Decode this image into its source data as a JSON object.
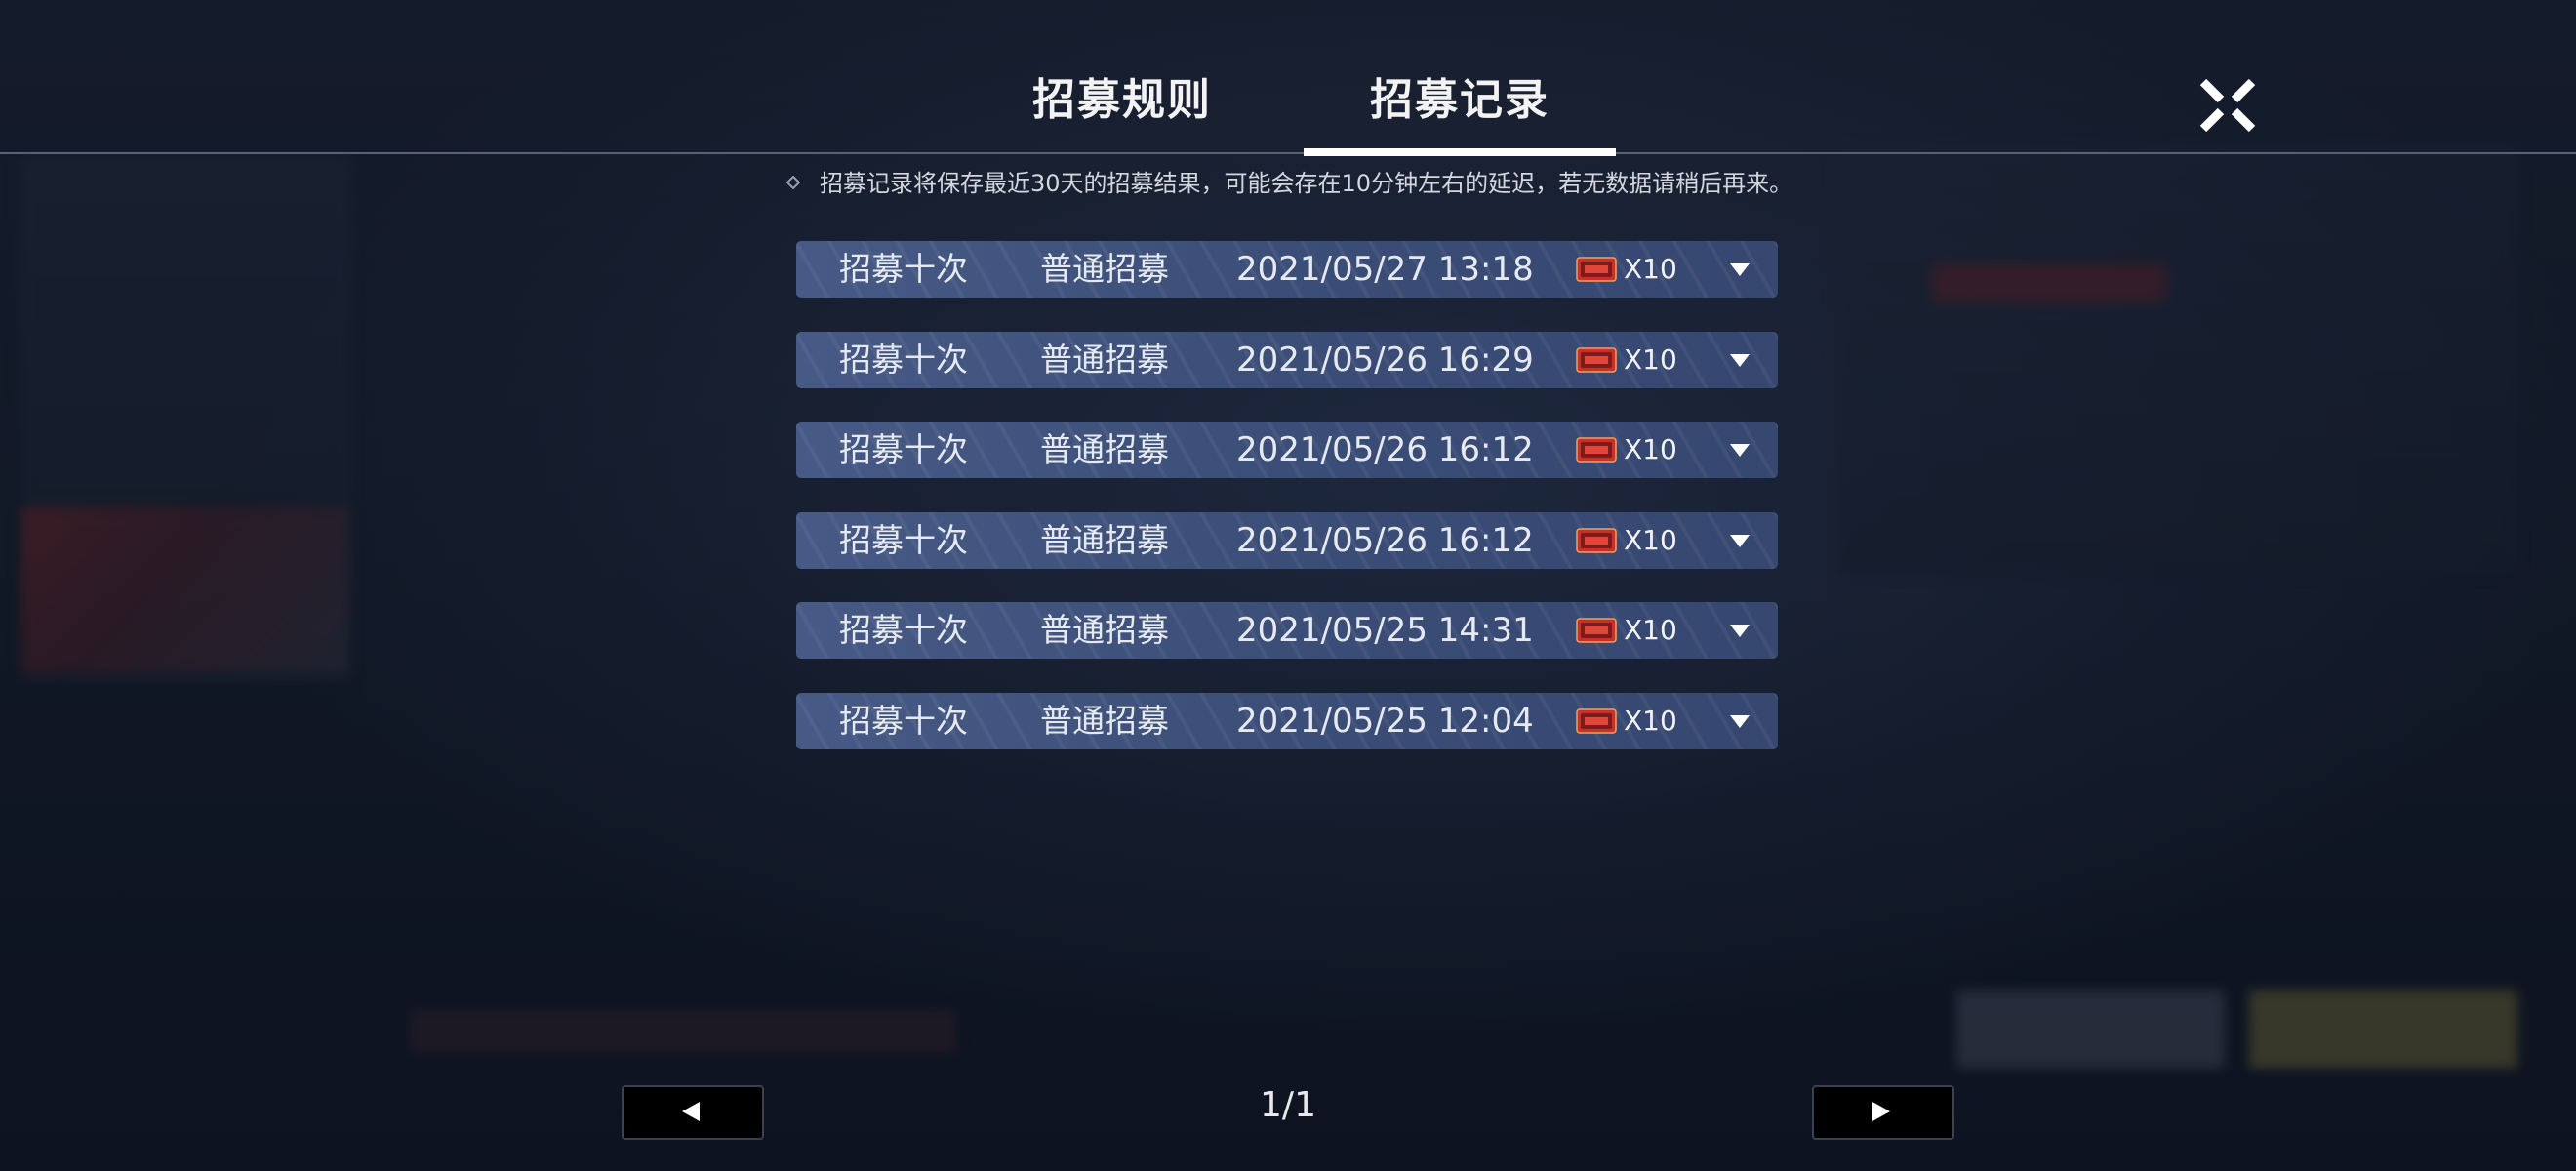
{
  "tabs": [
    {
      "label": "招募规则",
      "active": false
    },
    {
      "label": "招募记录",
      "active": true
    }
  ],
  "close_icon": "close-x-icon",
  "notice": {
    "icon": "diamond-outline-icon",
    "text": "招募记录将保存最近30天的招募结果，可能会存在10分钟左右的延迟，若无数据请稍后再来。"
  },
  "records": [
    {
      "type": "招募十次",
      "pool": "普通招募",
      "time": "2021/05/27 13:18",
      "ticket_icon": "red-ticket-icon",
      "count": "X10"
    },
    {
      "type": "招募十次",
      "pool": "普通招募",
      "time": "2021/05/26 16:29",
      "ticket_icon": "red-ticket-icon",
      "count": "X10"
    },
    {
      "type": "招募十次",
      "pool": "普通招募",
      "time": "2021/05/26 16:12",
      "ticket_icon": "red-ticket-icon",
      "count": "X10"
    },
    {
      "type": "招募十次",
      "pool": "普通招募",
      "time": "2021/05/26 16:12",
      "ticket_icon": "red-ticket-icon",
      "count": "X10"
    },
    {
      "type": "招募十次",
      "pool": "普通招募",
      "time": "2021/05/25 14:31",
      "ticket_icon": "red-ticket-icon",
      "count": "X10"
    },
    {
      "type": "招募十次",
      "pool": "普通招募",
      "time": "2021/05/25 12:04",
      "ticket_icon": "red-ticket-icon",
      "count": "X10"
    }
  ],
  "pager": {
    "page": "1/1",
    "prev_icon": "triangle-left-icon",
    "next_icon": "triangle-right-icon"
  },
  "colors": {
    "row_bg": "#3f5280",
    "accent_white": "#ffffff",
    "ticket_red": "#c8312b"
  }
}
